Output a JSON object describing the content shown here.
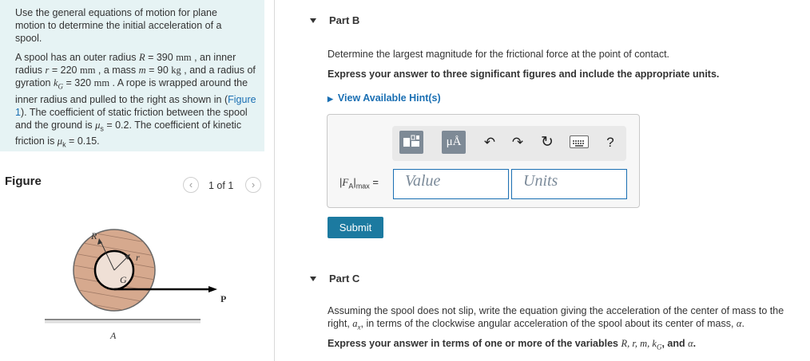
{
  "intro": {
    "line1": "Use the general equations of motion for plane motion to determine the initial acceleration of a spool.",
    "p2": {
      "a": "A spool has an outer radius ",
      "R": "R",
      "b": " = 390 ",
      "u1": "mm",
      "c": " , an inner radius ",
      "r": "r",
      "d": " = 220 ",
      "u2": "mm",
      "e": " , a mass ",
      "m": "m",
      "f": " = 90 ",
      "u3": "kg",
      "g": " , and a radius of gyration ",
      "kG": "k",
      "kGsub": "G",
      "h": " = 320 ",
      "u4": "mm",
      "i": " . A rope is wrapped around the inner radius and pulled to the right as shown in (",
      "figlink": "Figure 1",
      "j": "). The coefficient of static friction between the spool and the ground is ",
      "mus": "μ",
      "mussub": "s",
      "k": " = 0.2. The coefficient of kinetic friction is ",
      "muk": "μ",
      "muksub": "k",
      "l": " = 0.15."
    }
  },
  "figure": {
    "title": "Figure",
    "pager_text": "1 of 1",
    "prev": "‹",
    "next": "›",
    "labels": {
      "R": "R",
      "r": "r",
      "G": "G",
      "A": "A",
      "P": "P"
    }
  },
  "partB": {
    "heading": "Part B",
    "question": "Determine the largest magnitude for the frictional force at the point of contact.",
    "instruction": "Express your answer to three significant figures and include the appropriate units.",
    "hint": "View Available Hint(s)",
    "toolbar": {
      "units_label": "μÅ",
      "undo": "↶",
      "redo": "↷",
      "reset": "↻",
      "help": "?"
    },
    "answer_label": {
      "F": "F",
      "sub1": "A",
      "sub2": "max",
      "eq": "="
    },
    "value_placeholder": "Value",
    "units_placeholder": "Units",
    "submit": "Submit"
  },
  "partC": {
    "heading": "Part C",
    "q_a": "Assuming the spool does not slip, write the equation giving the acceleration of the center of mass to the right, ",
    "ax": "a",
    "axsub": "x",
    "q_b": ", in terms of the clockwise angular acceleration of the spool about its center of mass, ",
    "alpha": "α",
    "q_c": ".",
    "instr_a": "Express your answer in terms of one or more of the variables ",
    "vars": "R, r, m, k",
    "varsub": "G",
    "instr_b": ", and ",
    "instr_alpha": "α",
    "instr_c": "."
  }
}
